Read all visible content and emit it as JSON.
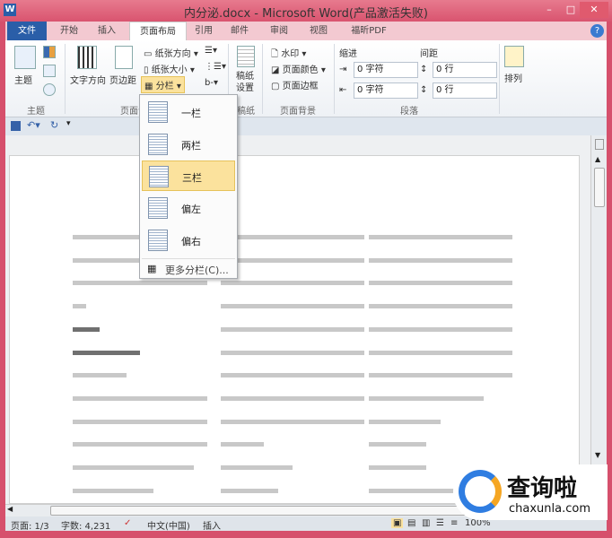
{
  "window": {
    "title": "内分泌.docx - Microsoft Word(产品激活失败)",
    "app_icon": "W",
    "minimize": "–",
    "maximize": "□",
    "close": "✕"
  },
  "tabs": [
    "文件",
    "开始",
    "插入",
    "页面布局",
    "引用",
    "邮件",
    "审阅",
    "视图",
    "福昕PDF"
  ],
  "active_tab": "页面布局",
  "ribbon": {
    "theme_group": {
      "label": "主题",
      "theme_button": "主题"
    },
    "page_setup": {
      "label": "页面设置",
      "text_direction": "文字方向",
      "margins": "页边距",
      "orientation": "纸张方向",
      "size": "纸张大小",
      "columns": "分栏"
    },
    "manuscript": {
      "label": "稿纸",
      "button": "稿纸\n设置"
    },
    "page_background": {
      "label": "页面背景",
      "watermark": "水印",
      "page_color": "页面颜色",
      "page_borders": "页面边框"
    },
    "paragraph": {
      "label": "段落",
      "indent_label": "缩进",
      "spacing_label": "间距",
      "indent_left": "0 字符",
      "indent_right": "0 字符",
      "spacing_before": "0 行",
      "spacing_after": "0 行"
    },
    "arrange": {
      "label": "排列"
    }
  },
  "columns_menu": {
    "items": [
      "一栏",
      "两栏",
      "三栏",
      "偏左",
      "偏右"
    ],
    "selected": "三栏",
    "more": "更多分栏(C)..."
  },
  "status": {
    "page": "页面: 1/3",
    "words": "字数: 4,231",
    "language": "中文(中国)",
    "mode": "插入",
    "zoom": "100%"
  },
  "watermark_logo": {
    "name": "查询啦",
    "url": "chaxunla.com"
  },
  "colors": {
    "title_bar": "#d9546f",
    "file_tab": "#2a5ea8",
    "menu_highlight": "#fbe29d"
  }
}
